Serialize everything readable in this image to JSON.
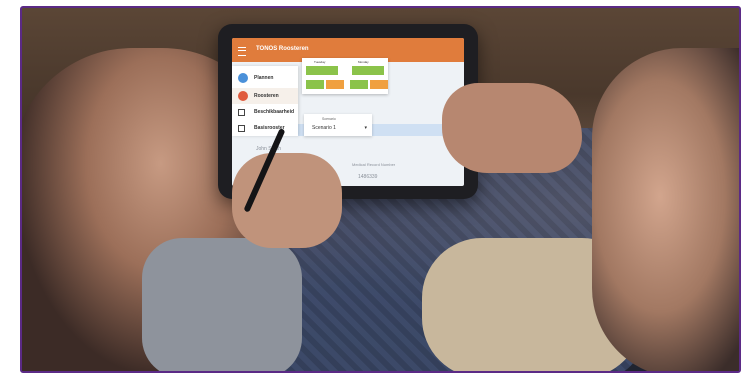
{
  "app": {
    "title": "TONOS Roosteren"
  },
  "sidebar": {
    "items": [
      {
        "label": "Plannen",
        "icon": "calendar-icon",
        "color": "#4a90d9"
      },
      {
        "label": "Roosteren",
        "icon": "people-icon",
        "color": "#e05a3c"
      }
    ]
  },
  "list": {
    "items": [
      {
        "label": "Beschikbaarheid",
        "icon": "availability-icon"
      },
      {
        "label": "Basisrooster",
        "icon": "calendar-grid-icon"
      }
    ]
  },
  "calendar": {
    "days": [
      "Tuesday",
      "Monday"
    ]
  },
  "scenario": {
    "caption": "Scenario",
    "value": "Scenario 1"
  },
  "background_text": {
    "name": "John Smith",
    "field": "Medical Record Number",
    "number": "1486339"
  },
  "colors": {
    "brand": "#e07c3c",
    "frame": "#5b2a86",
    "cell_green": "#8bc34a",
    "cell_orange": "#f0a040"
  }
}
